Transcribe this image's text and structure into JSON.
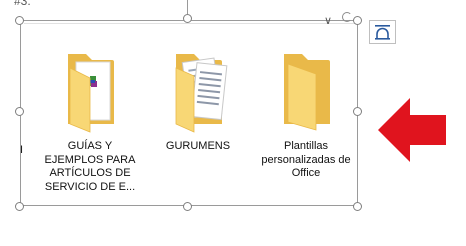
{
  "top_fragment": "#3.",
  "folders": [
    {
      "label": "GUÍAS Y EJEMPLOS PARA ARTÍCULOS DE SERVICIO DE E...",
      "icon": "folder-with-archive-icon"
    },
    {
      "label": "GURUMENS",
      "icon": "folder-with-documents-icon"
    },
    {
      "label": "Plantillas personalizadas de Office",
      "icon": "folder-icon"
    }
  ],
  "left_cut_label": "I",
  "colors": {
    "folder": "#F8D775",
    "folder_dark": "#E9B949",
    "arrow": "#E0141E"
  }
}
